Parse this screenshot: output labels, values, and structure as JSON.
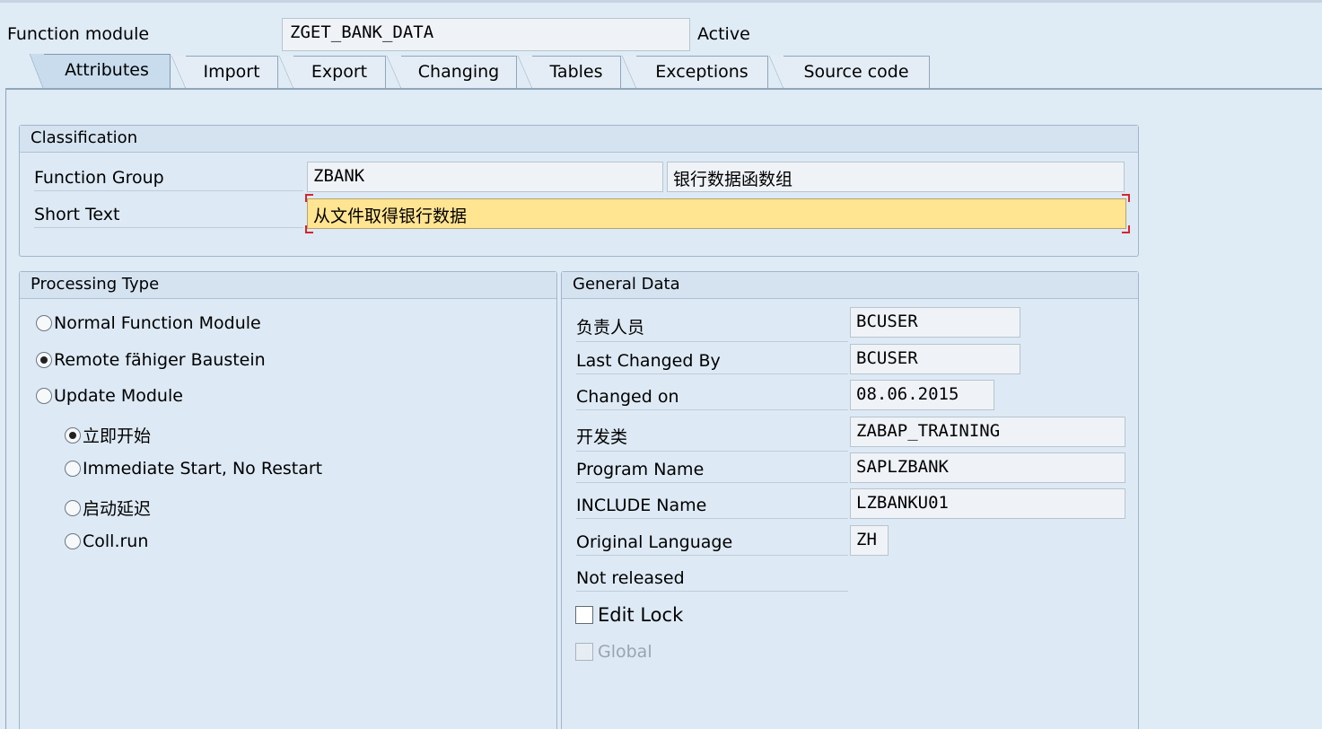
{
  "header": {
    "function_module_label": "Function module",
    "function_module_value": "ZGET_BANK_DATA",
    "status": "Active"
  },
  "tabs": [
    {
      "label": "Attributes",
      "active": true
    },
    {
      "label": "Import"
    },
    {
      "label": "Export"
    },
    {
      "label": "Changing"
    },
    {
      "label": "Tables"
    },
    {
      "label": "Exceptions"
    },
    {
      "label": "Source code"
    }
  ],
  "classification": {
    "title": "Classification",
    "function_group_label": "Function Group",
    "function_group_value": "ZBANK",
    "function_group_desc": "银行数据函数组",
    "short_text_label": "Short Text",
    "short_text_value": "从文件取得银行数据"
  },
  "processing_type": {
    "title": "Processing Type",
    "options": [
      {
        "label": "Normal Function Module",
        "selected": false
      },
      {
        "label": "Remote fähiger Baustein",
        "selected": true
      },
      {
        "label": "Update Module",
        "selected": false
      }
    ],
    "update_options": [
      {
        "label": "立即开始",
        "selected": true
      },
      {
        "label": "Immediate Start, No Restart",
        "selected": false
      },
      {
        "label": "启动延迟",
        "selected": false
      },
      {
        "label": "Coll.run",
        "selected": false
      }
    ]
  },
  "general_data": {
    "title": "General Data",
    "responsible_label": "负责人员",
    "responsible_value": "BCUSER",
    "last_changed_by_label": "Last Changed By",
    "last_changed_by_value": "BCUSER",
    "changed_on_label": "Changed on",
    "changed_on_value": "08.06.2015",
    "package_label": "开发类",
    "package_value": "ZABAP_TRAINING",
    "program_name_label": "Program Name",
    "program_name_value": "SAPLZBANK",
    "include_name_label": "INCLUDE Name",
    "include_name_value": "LZBANKU01",
    "original_language_label": "Original Language",
    "original_language_value": "ZH",
    "release_status": "Not released",
    "edit_lock_label": "Edit Lock",
    "global_label": "Global"
  }
}
